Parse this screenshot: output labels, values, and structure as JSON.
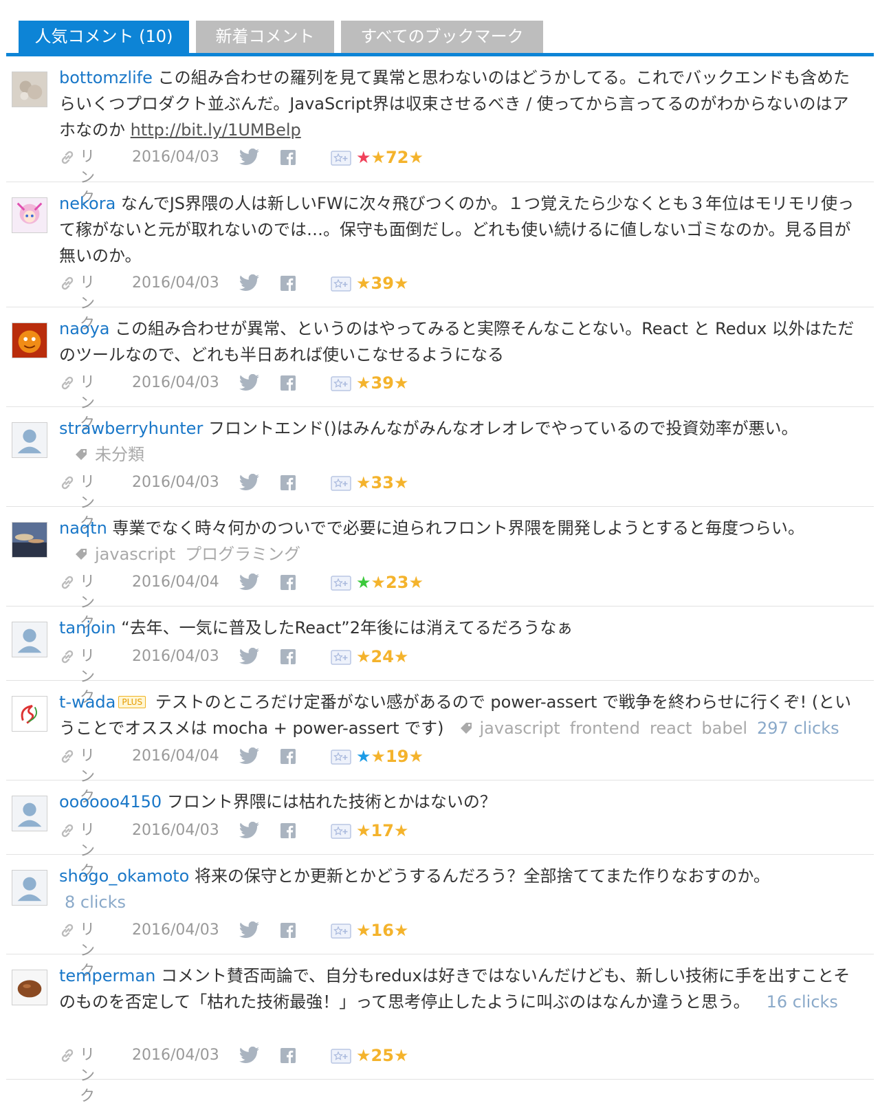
{
  "tabs": [
    {
      "label": "人気コメント (10)",
      "active": true
    },
    {
      "label": "新着コメント",
      "active": false
    },
    {
      "label": "すべてのブックマーク",
      "active": false
    }
  ],
  "link_label": "リンク",
  "comments": [
    {
      "user": "bottomzlife",
      "text": "この組み合わせの羅列を見て異常と思わないのはどうかしてる。これでバックエンドも含めたらいくつプロダクト並ぶんだ。JavaScript界は収束させるべき / 使ってから言ってるのがわからないのはアホなのか",
      "url": "http://bit.ly/1UMBelp",
      "date": "2016/04/03",
      "stars": "72",
      "star_colors": [
        "#f0415a",
        "#f4b32c"
      ]
    },
    {
      "user": "nekora",
      "text": "なんでJS界隈の人は新しいFWに次々飛びつくのか。１つ覚えたら少なくとも３年位はモリモリ使って稼がないと元が取れないのでは…。保守も面倒だし。どれも使い続けるに値しないゴミなのか。見る目が無いのか。",
      "date": "2016/04/03",
      "stars": "39",
      "star_colors": [
        "#f4b32c"
      ]
    },
    {
      "user": "naoya",
      "text": "この組み合わせが異常、というのはやってみると実際そんなことない。React と Redux 以外はただのツールなので、どれも半日あれば使いこなせるようになる",
      "date": "2016/04/03",
      "stars": "39",
      "star_colors": [
        "#f4b32c"
      ]
    },
    {
      "user": "strawberryhunter",
      "text": "フロントエンド()はみんながみんなオレオレでやっているので投資効率が悪い。",
      "tags": [
        "未分類"
      ],
      "date": "2016/04/03",
      "stars": "33",
      "star_colors": [
        "#f4b32c"
      ]
    },
    {
      "user": "naqtn",
      "text": "専業でなく時々何かのついでで必要に迫られフロント界隈を開発しようとすると毎度つらい。",
      "tags": [
        "javascript",
        "プログラミング"
      ],
      "date": "2016/04/04",
      "stars": "23",
      "star_colors": [
        "#3bc93b",
        "#f4b32c"
      ]
    },
    {
      "user": "tanjoin",
      "text": "“去年、一気に普及したReact”2年後には消えてるだろうなぁ",
      "date": "2016/04/03",
      "stars": "24",
      "star_colors": [
        "#f4b32c"
      ]
    },
    {
      "user": "t-wada",
      "plus": "PLUS",
      "text": "テストのところだけ定番がない感があるので power-assert で戦争を終わらせに行くぞ! (ということでオススメは mocha + power-assert です)",
      "tags": [
        "javascript",
        "frontend",
        "react",
        "babel"
      ],
      "clicks": "297 clicks",
      "date": "2016/04/04",
      "stars": "19",
      "star_colors": [
        "#1c9be6",
        "#f4b32c"
      ]
    },
    {
      "user": "oooooo4150",
      "text": "フロント界隈には枯れた技術とかはないの？",
      "date": "2016/04/03",
      "stars": "17",
      "star_colors": [
        "#f4b32c"
      ]
    },
    {
      "user": "shogo_okamoto",
      "text": "将来の保守とか更新とかどうするんだろう？全部捨ててまた作りなおすのか。",
      "clicks": "8 clicks",
      "date": "2016/04/03",
      "stars": "16",
      "star_colors": [
        "#f4b32c"
      ]
    },
    {
      "user": "temperman",
      "text": "コメント賛否両論で、自分もreduxは好きではないんだけども、新しい技術に手を出すことそのものを否定して「枯れた技術最強！」って思考停止したように叫ぶのはなんか違うと思う。",
      "clicks": "16 clicks",
      "date": "2016/04/03",
      "stars": "25",
      "star_colors": [
        "#f4b32c"
      ]
    }
  ]
}
